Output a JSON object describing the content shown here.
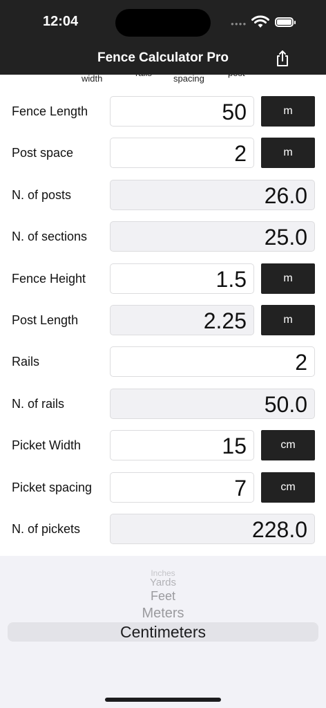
{
  "status": {
    "time": "12:04"
  },
  "nav": {
    "title": "Fence Calculator Pro"
  },
  "partial_labels": [
    "width",
    "rails",
    "spacing",
    "post"
  ],
  "rows": [
    {
      "label": "Fence Length",
      "value": "50",
      "editable": true,
      "unit": "m"
    },
    {
      "label": "Post space",
      "value": "2",
      "editable": true,
      "unit": "m"
    },
    {
      "label": "N. of posts",
      "value": "26.0",
      "editable": false
    },
    {
      "label": "N. of sections",
      "value": "25.0",
      "editable": false
    },
    {
      "label": "Fence Height",
      "value": "1.5",
      "editable": true,
      "unit": "m"
    },
    {
      "label": "Post Length",
      "value": "2.25",
      "editable": false,
      "unit": "m"
    },
    {
      "label": "Rails",
      "value": "2",
      "editable": true
    },
    {
      "label": "N. of rails",
      "value": "50.0",
      "editable": false
    },
    {
      "label": "Picket Width",
      "value": "15",
      "editable": true,
      "unit": "cm"
    },
    {
      "label": "Picket spacing",
      "value": "7",
      "editable": true,
      "unit": "cm"
    },
    {
      "label": "N. of pickets",
      "value": "228.0",
      "editable": false
    }
  ],
  "picker": {
    "items": [
      "Inches",
      "Yards",
      "Feet",
      "Meters",
      "Centimeters"
    ],
    "selected": "Centimeters"
  },
  "colors": {
    "header_bg": "#222222",
    "readonly_bg": "#f1f1f4",
    "picker_bg": "#f2f2f7"
  }
}
